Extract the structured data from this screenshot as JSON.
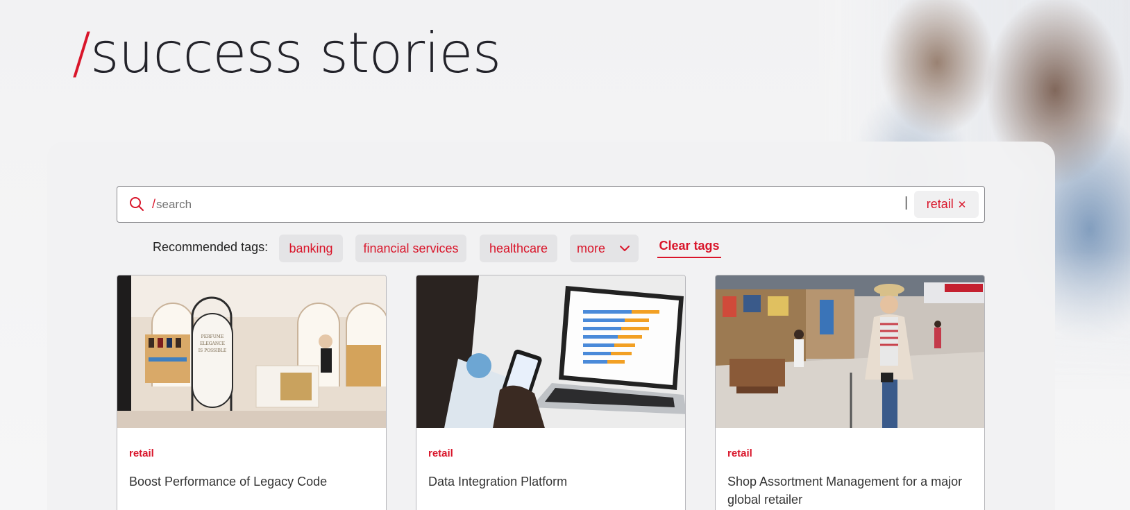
{
  "hero": {
    "title_slash": "/",
    "title": "success stories"
  },
  "search": {
    "slash": "/",
    "placeholder": "search",
    "divider": "|",
    "active_tag": "retail",
    "active_tag_remove": "✕"
  },
  "tags": {
    "label": "Recommended tags:",
    "items": [
      "banking",
      "financial services",
      "healthcare"
    ],
    "more_label": "more",
    "clear_label": "Clear tags"
  },
  "cards": [
    {
      "tag": "retail",
      "title": "Boost Performance of Legacy Code"
    },
    {
      "tag": "retail",
      "title": "Data Integration Platform"
    },
    {
      "tag": "retail",
      "title": "Shop Assortment Management for a major global retailer"
    }
  ],
  "colors": {
    "accent": "#d9152a",
    "tag_bg": "#e4e4e6",
    "panel_bg": "#f1f1f2"
  },
  "icons": {
    "search": "search-icon",
    "close": "close-icon",
    "chevron": "chevron-down-icon"
  }
}
